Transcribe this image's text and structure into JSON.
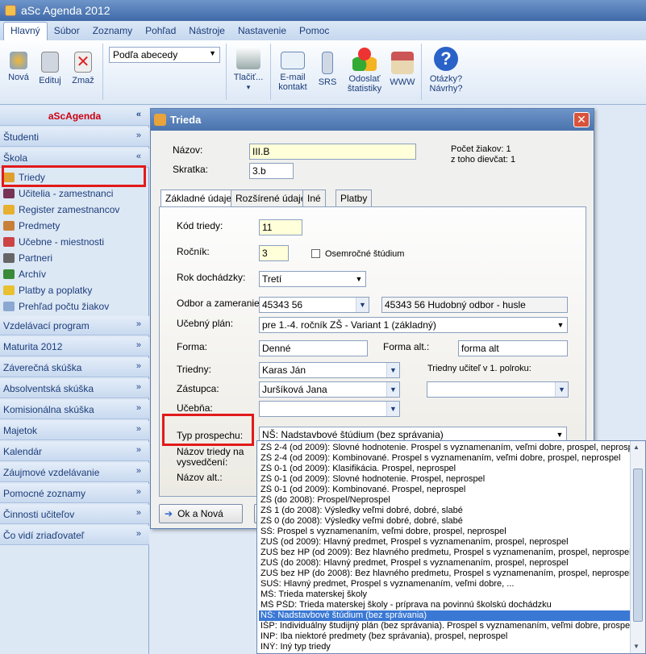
{
  "app": {
    "title": "aSc Agenda 2012"
  },
  "menu": [
    "Hlavný",
    "Súbor",
    "Zoznamy",
    "Pohľad",
    "Nástroje",
    "Nastavenie",
    "Pomoc"
  ],
  "ribbon": {
    "nova": "Nová",
    "edituj": "Edituj",
    "zmaz": "Zmaž",
    "sort": "Podľa abecedy",
    "tlacit": "Tlačiť...",
    "email1": "E-mail",
    "email2": "kontakt",
    "srs": "SRS",
    "odoslat1": "Odoslať",
    "odoslat2": "štatistiky",
    "www": "WWW",
    "otazky1": "Otázky?",
    "otazky2": "Návrhy?"
  },
  "sidebar": {
    "brand": "aScAgenda",
    "sections": [
      "Študenti",
      "Škola",
      "Vzdelávací program",
      "Maturita 2012",
      "Záverečná skúška",
      "Absolventská skúška",
      "Komisionálna skúška",
      "Majetok",
      "Kalendár",
      "Záujmové vzdelávanie",
      "Pomocné zoznamy",
      "Činnosti učiteľov",
      "Čo vidí zriaďovateľ"
    ],
    "items": [
      "Triedy",
      "Učitelia - zamestnanci",
      "Register zamestnancov",
      "Predmety",
      "Učebne - miestnosti",
      "Partneri",
      "Archív",
      "Platby a poplatky",
      "Prehľad počtu žiakov"
    ]
  },
  "dialog": {
    "title": "Trieda",
    "nazov_label": "Názov:",
    "nazov": "III.B",
    "skratka_label": "Skratka:",
    "skratka": "3.b",
    "pocet1": "Počet žiakov: 1",
    "pocet2": "z toho dievčat: 1",
    "tabs": [
      "Základné údaje",
      "Rozšírené údaje",
      "Iné",
      "Platby"
    ],
    "kod_label": "Kód triedy:",
    "kod": "11",
    "rocnik_label": "Ročník:",
    "rocnik": "3",
    "osem": "Osemročné štúdium",
    "rok_label": "Rok dochádzky:",
    "rok": "Tretí",
    "odbor_label": "Odbor a zameranie:",
    "odbor": "45343 56",
    "odbor_desc": "45343 56 Hudobný odbor - husle",
    "plan_label": "Učebný plán:",
    "plan": "pre 1.-4. ročník ZŠ - Variant 1 (základný)",
    "forma_label": "Forma:",
    "forma": "Denné",
    "formaalt_label": "Forma alt.:",
    "formaalt": "forma alt",
    "triedny_label": "Triedny:",
    "triedny": "Karas Ján",
    "triedny1_label": "Triedny učiteľ v 1. polroku:",
    "zastupca_label": "Zástupca:",
    "zastupca": "Juršíková Jana",
    "ucebna_label": "Učebňa:",
    "typ_label": "Typ prospechu:",
    "typ": "NŠ: Nadstavbové štúdium (bez správania)",
    "naz_vysv1": "Názov triedy na",
    "naz_vysv2": "vysvedčení:",
    "naz_alt": "Názov alt.:",
    "ok": "Ok a Nová"
  },
  "options": [
    "ZŠ 2-4 (od 2009): Slovné hodnotenie. Prospel s vyznamenaním, veľmi dobre, prospel, neprospel",
    "ZŠ 2-4 (od 2009): Kombinované. Prospel s vyznamenaním, veľmi dobre, prospel, neprospel",
    "ZŠ 0-1 (od 2009): Klasifikácia. Prospel, neprospel",
    "ZŠ 0-1 (od 2009): Slovné hodnotenie. Prospel, neprospel",
    "ZŠ 0-1 (od 2009): Kombinované. Prospel, neprospel",
    "ZŠ (do 2008): Prospel/Neprospel",
    "ZŠ 1 (do 2008): Výsledky veľmi dobré, dobré, slabé",
    "ZŠ 0 (do 2008): Výsledky veľmi dobré, dobré, slabé",
    "SŠ: Prospel s vyznamenaním, veľmi dobre, prospel, neprospel",
    "ZUŠ (od 2009): Hlavný predmet, Prospel s vyznamenaním, prospel, neprospel",
    "ZUŠ bez HP (od 2009): Bez hlavného predmetu, Prospel s vyznamenaním, prospel, neprospel",
    "ZUŠ (do 2008): Hlavný predmet, Prospel s vyznamenaním, prospel, neprospel",
    "ZUŠ bez HP (do 2008): Bez hlavného predmetu, Prospel s vyznamenaním, prospel, neprospel",
    "SUŠ: Hlavný predmet, Prospel s vyznamenaním, veľmi dobre, ...",
    "MŠ: Trieda materskej školy",
    "MŠ PŠD: Trieda materskej školy - príprava na povinnú školskú dochádzku",
    "NŠ: Nadstavbové štúdium (bez správania)",
    "IŠP: Individuálny študijný plán (bez správania). Prospel s vyznamenaním, veľmi dobre, prospel, neprospel",
    "INP: Iba niektoré predmety (bez správania), prospel, neprospel",
    "INÝ: Iný typ triedy"
  ]
}
